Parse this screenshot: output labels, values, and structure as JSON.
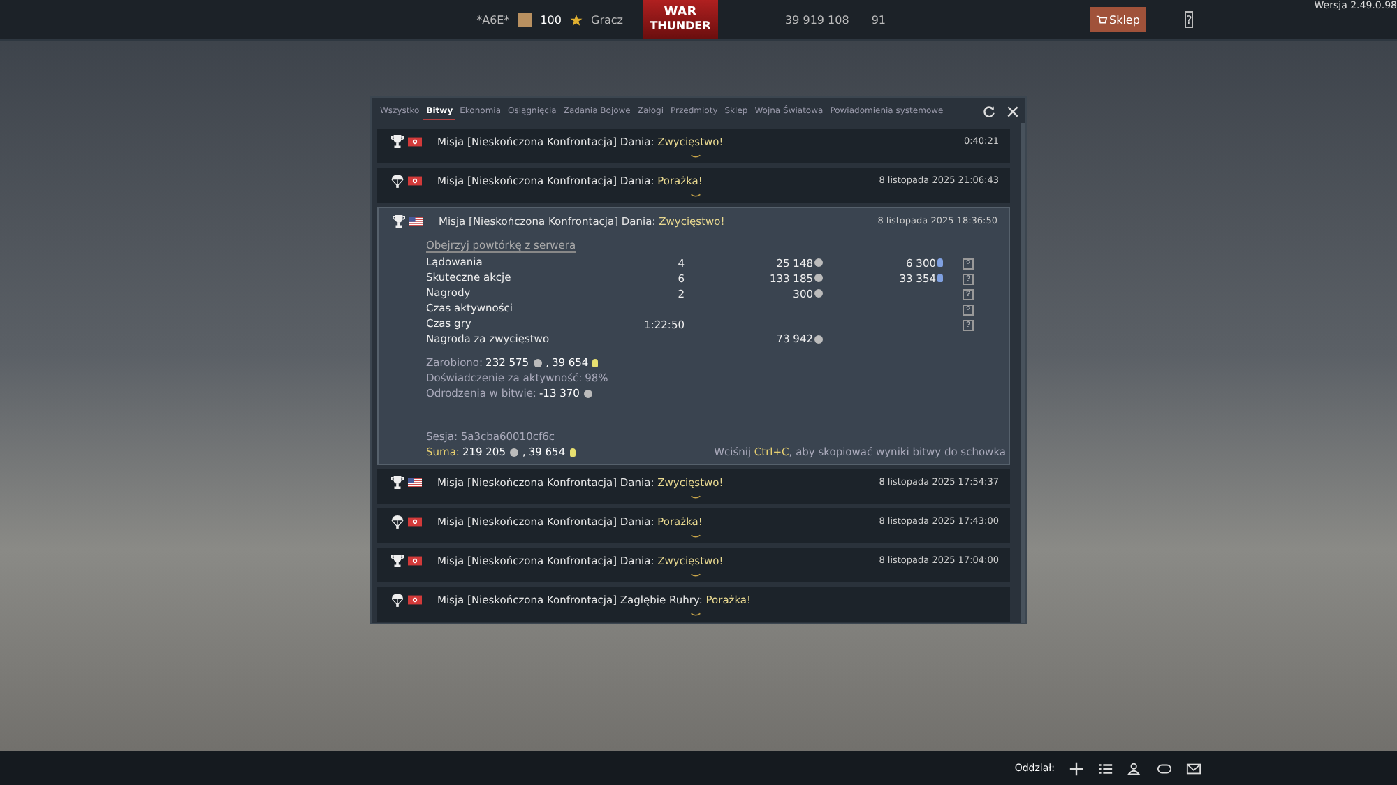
{
  "top_bar": {
    "squadron_tag": "*A6E*",
    "level": "100",
    "title": "Gracz",
    "logo_top": "WAR",
    "logo_bottom": "THUNDER",
    "silver_lions": "39 919 108",
    "golden_eagles": "91",
    "shop_button": "Sklep",
    "help_button": "?",
    "version": "Wersja 2.49.0.98"
  },
  "tabs": [
    {
      "label": "Wszystko",
      "selected": false
    },
    {
      "label": "Bitwy",
      "selected": true
    },
    {
      "label": "Ekonomia",
      "selected": false
    },
    {
      "label": "Osiągnięcia",
      "selected": false
    },
    {
      "label": "Zadania Bojowe",
      "selected": false
    },
    {
      "label": "Załogi",
      "selected": false
    },
    {
      "label": "Przedmioty",
      "selected": false
    },
    {
      "label": "Sklep",
      "selected": false
    },
    {
      "label": "Wojna Światowa",
      "selected": false
    },
    {
      "label": "Powiadomienia systemowe",
      "selected": false
    }
  ],
  "battles": [
    {
      "kind": "victory",
      "us_flag": false,
      "mission": "Misja [Nieskończona Konfrontacja] Dania:",
      "outcome": "Zwycięstwo!",
      "time": "0:40:21",
      "expanded": false
    },
    {
      "kind": "defeat",
      "us_flag": false,
      "mission": "Misja [Nieskończona Konfrontacja] Dania:",
      "outcome": "Porażka!",
      "time": "8 listopada 2025 21:06:43",
      "expanded": false
    },
    {
      "kind": "victory",
      "us_flag": true,
      "mission": "Misja [Nieskończona Konfrontacja] Dania:",
      "outcome": "Zwycięstwo!",
      "time": "8 listopada 2025 18:36:50",
      "expanded": true
    },
    {
      "kind": "victory",
      "us_flag": true,
      "mission": "Misja [Nieskończona Konfrontacja] Dania:",
      "outcome": "Zwycięstwo!",
      "time": "8 listopada 2025 17:54:37",
      "expanded": false
    },
    {
      "kind": "defeat",
      "us_flag": false,
      "mission": "Misja [Nieskończona Konfrontacja] Dania:",
      "outcome": "Porażka!",
      "time": "8 listopada 2025 17:43:00",
      "expanded": false
    },
    {
      "kind": "victory",
      "us_flag": false,
      "mission": "Misja [Nieskończona Konfrontacja] Dania:",
      "outcome": "Zwycięstwo!",
      "time": "8 listopada 2025 17:04:00",
      "expanded": false
    },
    {
      "kind": "defeat",
      "us_flag": false,
      "mission": "Misja [Nieskończona Konfrontacja] Zagłębie Ruhry:",
      "outcome": "Porażka!",
      "expanded": false
    }
  ],
  "details": {
    "replay_link": "Obejrzyj powtórkę z serwera",
    "rows": [
      {
        "name": "Lądowania",
        "count": "4",
        "silver": "25 148",
        "rp": "6 300",
        "help": "?"
      },
      {
        "name": "Skuteczne akcje",
        "count": "6",
        "silver": "133 185",
        "rp": "33 354",
        "help": "?"
      },
      {
        "name": "Nagrody",
        "count": "2",
        "silver": "300",
        "help": "?"
      },
      {
        "name": "Czas aktywności",
        "help": "?"
      },
      {
        "name": "Czas gry",
        "count": "1:22:50",
        "help": "?"
      },
      {
        "name": "Nagroda za zwycięstwo",
        "silver": "73 942"
      }
    ],
    "earned": {
      "label": "Zarobiono:",
      "silver": "232 575",
      "separator": ",",
      "rp": "39 654"
    },
    "activity": {
      "label": "Doświadczenie za aktywność:",
      "value": "98%"
    },
    "respawns": {
      "label": "Odrodzenia w bitwie:",
      "silver": "-13 370"
    },
    "session": "Sesja: 5a3cba60010cf6c",
    "total": {
      "label": "Suma:",
      "silver": "219 205",
      "separator": ",",
      "rp": "39 654"
    },
    "hint": {
      "before": "Wciśnij",
      "key": "Ctrl+C",
      "after": ", aby skopiować wyniki bitwy do schowka"
    }
  },
  "bottom_bar": {
    "squad_label": "Oddział:"
  }
}
